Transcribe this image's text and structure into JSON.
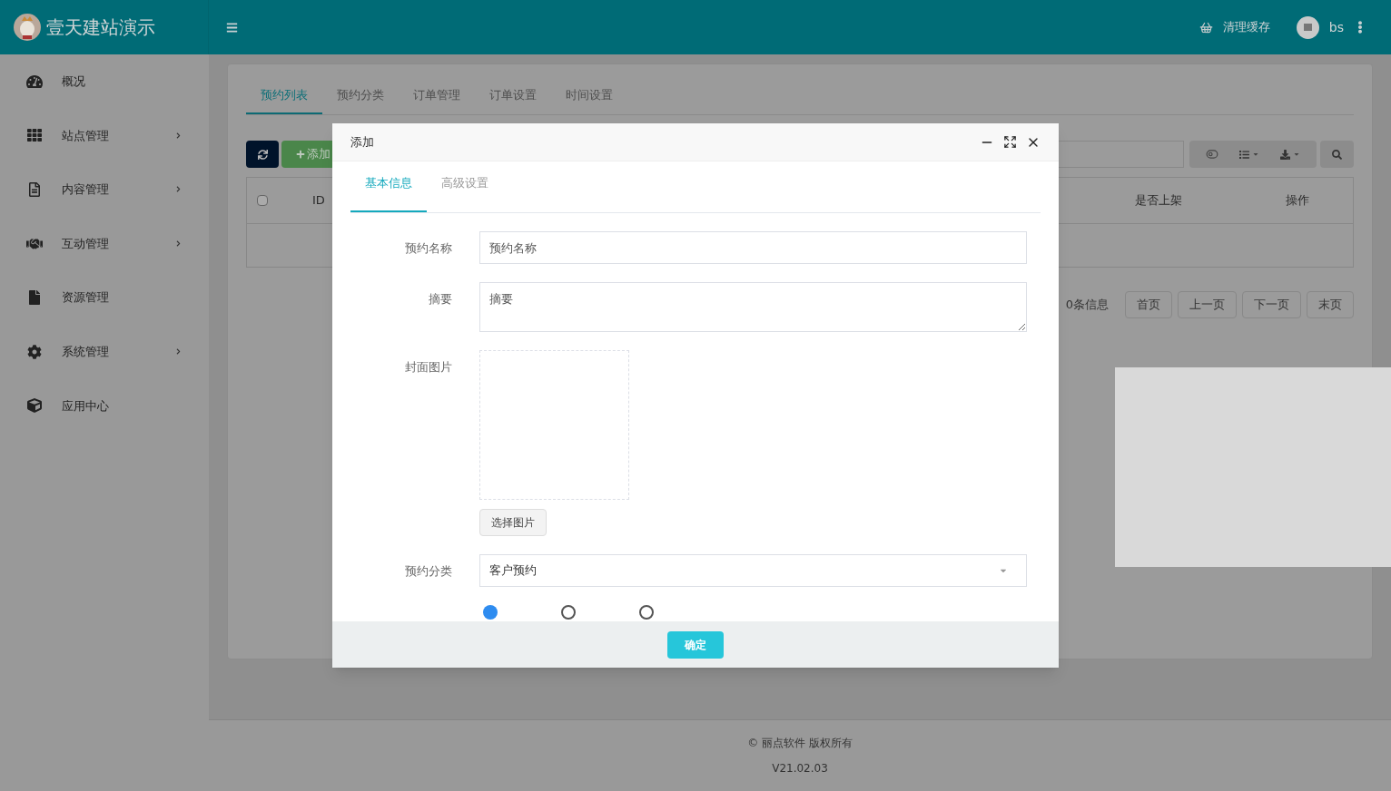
{
  "header": {
    "site_name": "壹天建站演示",
    "clear_cache": "清理缓存",
    "user": "bs"
  },
  "sidebar": {
    "items": [
      {
        "label": "概况",
        "has_submenu": false
      },
      {
        "label": "站点管理",
        "has_submenu": true
      },
      {
        "label": "内容管理",
        "has_submenu": true
      },
      {
        "label": "互动管理",
        "has_submenu": true
      },
      {
        "label": "资源管理",
        "has_submenu": false
      },
      {
        "label": "系统管理",
        "has_submenu": true
      },
      {
        "label": "应用中心",
        "has_submenu": false
      }
    ]
  },
  "tabs": [
    {
      "label": "预约列表",
      "selected": true
    },
    {
      "label": "预约分类",
      "selected": false
    },
    {
      "label": "订单管理",
      "selected": false
    },
    {
      "label": "订单设置",
      "selected": false
    },
    {
      "label": "时间设置",
      "selected": false
    }
  ],
  "toolbar": {
    "add": "添加"
  },
  "table": {
    "select_all_checked": false,
    "columns": [
      "ID",
      "是否上架",
      "操作"
    ]
  },
  "pagination": {
    "info": "0条信息",
    "buttons": [
      "首页",
      "上一页",
      "下一页",
      "末页"
    ]
  },
  "dialog": {
    "title": "添加",
    "tabs": [
      {
        "label": "基本信息",
        "selected": true
      },
      {
        "label": "高级设置",
        "selected": false
      }
    ],
    "fields": [
      {
        "kind": "text",
        "label": "预约名称",
        "placeholder": "预约名称"
      },
      {
        "kind": "textarea",
        "label": "摘要",
        "placeholder": "摘要"
      },
      {
        "kind": "image",
        "label": "封面图片",
        "button": "选择图片"
      },
      {
        "kind": "select",
        "label": "预约分类",
        "value": "客户预约"
      },
      {
        "kind": "radio",
        "options": [
          {
            "selected": true
          },
          {
            "selected": false
          },
          {
            "selected": false
          }
        ]
      }
    ],
    "confirm": "确定"
  },
  "footer": {
    "copyright": "© 丽点软件 版权所有",
    "version": "V21.02.03"
  }
}
